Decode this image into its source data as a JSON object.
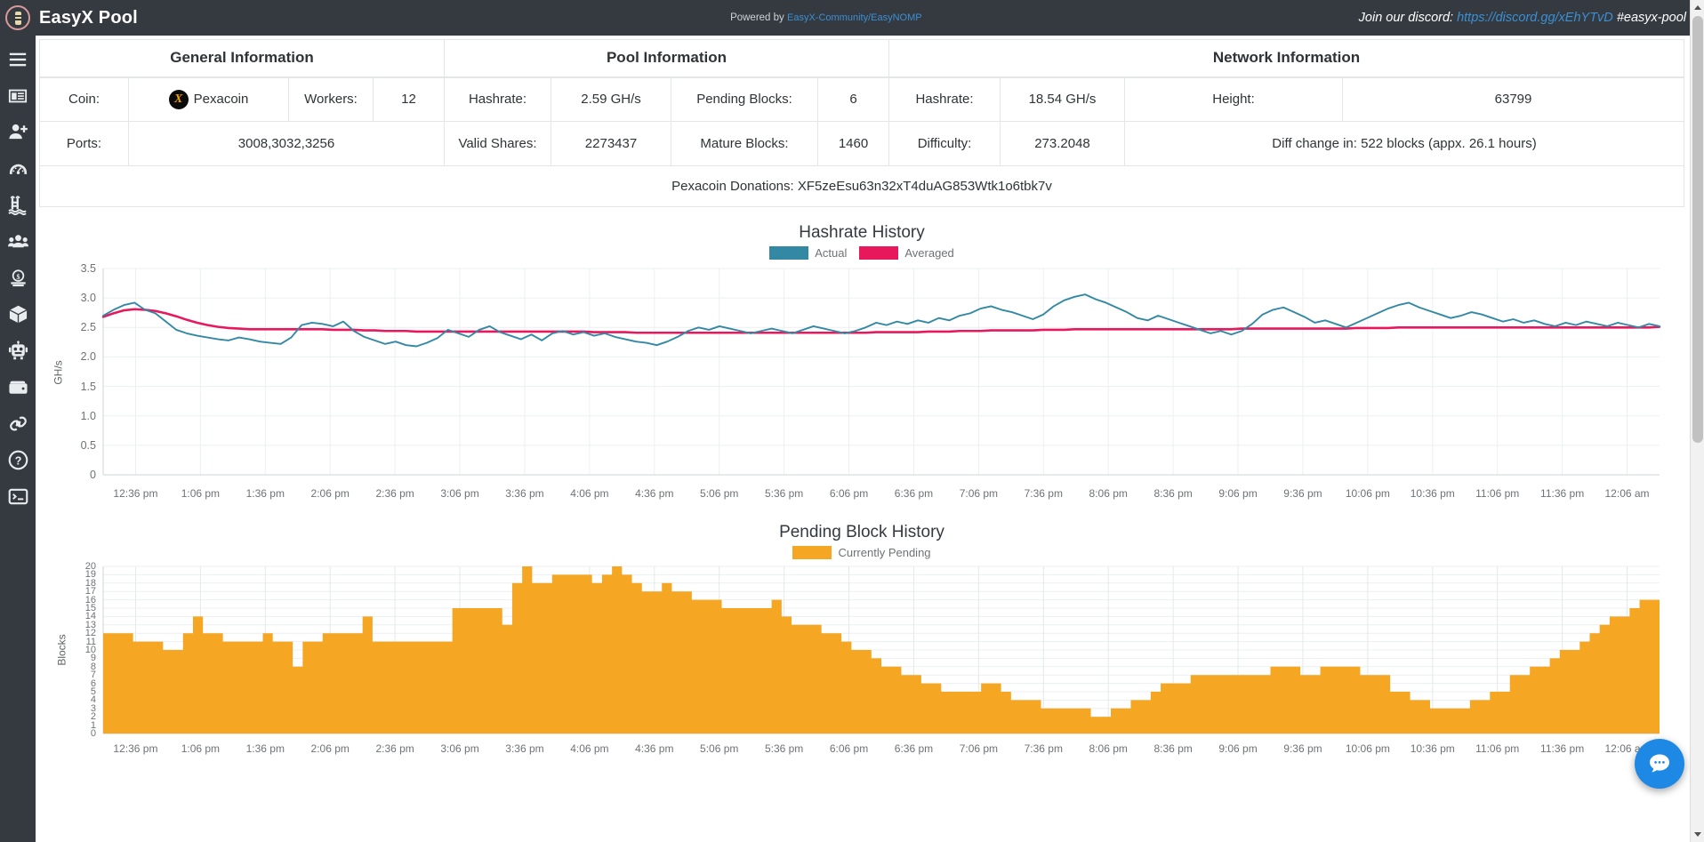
{
  "header": {
    "brand_title": "EasyX Pool",
    "logo_icon": "pool-logo-icon",
    "powered_prefix": "Powered by",
    "powered_link": "EasyX-Community/EasyNOMP",
    "discord_prefix": "Join our discord:",
    "discord_link": "https://discord.gg/xEhYTvD",
    "discord_channel": "#easyx-pool",
    "bg_color": "#343a40",
    "link_color": "#3b8fd4"
  },
  "sidebar": {
    "items": [
      {
        "icon": "hamburger-menu-icon",
        "label": "Menu"
      },
      {
        "icon": "news-article-icon",
        "label": "News"
      },
      {
        "icon": "user-add-icon",
        "label": "Get Started"
      },
      {
        "icon": "gauge-dashboard-icon",
        "label": "Dashboard"
      },
      {
        "icon": "pool-ladder-icon",
        "label": "Pool Stats"
      },
      {
        "icon": "users-group-icon",
        "label": "Miners"
      },
      {
        "icon": "coin-dollar-icon",
        "label": "Payments"
      },
      {
        "icon": "cube-block-icon",
        "label": "Blocks"
      },
      {
        "icon": "robot-icon",
        "label": "Bot"
      },
      {
        "icon": "wallet-icon",
        "label": "Wallet"
      },
      {
        "icon": "link-chain-icon",
        "label": "Links"
      },
      {
        "icon": "question-circle-icon",
        "label": "Help"
      },
      {
        "icon": "terminal-console-icon",
        "label": "Console"
      }
    ]
  },
  "info_table": {
    "group_headers": [
      "General Information",
      "Pool Information",
      "Network Information"
    ],
    "row1": [
      {
        "label": "Coin:",
        "value": "Pexacoin",
        "icon": "pexacoin-coin-icon"
      },
      {
        "label": "Workers:",
        "value": "12"
      },
      {
        "label": "Hashrate:",
        "value": "2.59 GH/s"
      },
      {
        "label": "Pending Blocks:",
        "value": "6"
      },
      {
        "label": "Hashrate:",
        "value": "18.54 GH/s"
      },
      {
        "label": "Height:",
        "value": "63799"
      }
    ],
    "row2": [
      {
        "label": "Ports:",
        "value": "3008,3032,3256"
      },
      {
        "label": "Valid Shares:",
        "value": "2273437"
      },
      {
        "label": "Mature Blocks:",
        "value": "1460"
      },
      {
        "label": "Difficulty:",
        "value": "273.2048"
      },
      {
        "label": "",
        "value": "Diff change in: 522 blocks (appx. 26.1 hours)"
      }
    ],
    "donations": "Pexacoin Donations: XF5zeEsu63n32xT4duAG853Wtk1o6tbk7v"
  },
  "chart_data": [
    {
      "type": "line",
      "title": "Hashrate History",
      "xlabel": "",
      "ylabel": "GH/s",
      "ylim": [
        0,
        3.5
      ],
      "ytick_labels": [
        "0",
        "0.5",
        "1.0",
        "1.5",
        "2.0",
        "2.5",
        "3.0",
        "3.5"
      ],
      "ytick_values": [
        0,
        0.5,
        1.0,
        1.5,
        2.0,
        2.5,
        3.0,
        3.5
      ],
      "grid": true,
      "legend_position": "top-center",
      "xtick_labels": [
        "12:36 pm",
        "1:06 pm",
        "1:36 pm",
        "2:06 pm",
        "2:36 pm",
        "3:06 pm",
        "3:36 pm",
        "4:06 pm",
        "4:36 pm",
        "5:06 pm",
        "5:36 pm",
        "6:06 pm",
        "6:36 pm",
        "7:06 pm",
        "7:36 pm",
        "8:06 pm",
        "8:36 pm",
        "9:06 pm",
        "9:36 pm",
        "10:06 pm",
        "10:36 pm",
        "11:06 pm",
        "11:36 pm",
        "12:06 am"
      ],
      "series": [
        {
          "name": "Actual",
          "color": "#3389a4",
          "values": [
            2.7,
            2.8,
            2.88,
            2.92,
            2.8,
            2.74,
            2.6,
            2.46,
            2.4,
            2.36,
            2.33,
            2.3,
            2.28,
            2.33,
            2.3,
            2.26,
            2.24,
            2.22,
            2.33,
            2.54,
            2.58,
            2.56,
            2.52,
            2.6,
            2.44,
            2.34,
            2.28,
            2.22,
            2.26,
            2.2,
            2.18,
            2.24,
            2.32,
            2.46,
            2.4,
            2.34,
            2.46,
            2.52,
            2.42,
            2.36,
            2.3,
            2.38,
            2.28,
            2.4,
            2.44,
            2.38,
            2.42,
            2.36,
            2.4,
            2.34,
            2.3,
            2.26,
            2.24,
            2.2,
            2.26,
            2.34,
            2.44,
            2.5,
            2.46,
            2.52,
            2.48,
            2.44,
            2.4,
            2.44,
            2.48,
            2.44,
            2.4,
            2.46,
            2.52,
            2.48,
            2.44,
            2.4,
            2.44,
            2.5,
            2.58,
            2.54,
            2.6,
            2.56,
            2.62,
            2.58,
            2.66,
            2.62,
            2.7,
            2.74,
            2.82,
            2.86,
            2.8,
            2.76,
            2.7,
            2.64,
            2.72,
            2.86,
            2.96,
            3.02,
            3.06,
            2.98,
            2.92,
            2.84,
            2.76,
            2.66,
            2.62,
            2.7,
            2.64,
            2.58,
            2.52,
            2.46,
            2.4,
            2.44,
            2.38,
            2.44,
            2.56,
            2.72,
            2.8,
            2.84,
            2.76,
            2.68,
            2.58,
            2.62,
            2.56,
            2.5,
            2.58,
            2.66,
            2.74,
            2.82,
            2.88,
            2.92,
            2.84,
            2.78,
            2.72,
            2.66,
            2.7,
            2.76,
            2.72,
            2.66,
            2.6,
            2.64,
            2.58,
            2.62,
            2.56,
            2.52,
            2.58,
            2.54,
            2.6,
            2.56,
            2.52,
            2.58,
            2.54,
            2.5,
            2.56,
            2.52
          ]
        },
        {
          "name": "Averaged",
          "color": "#e8185c",
          "values": [
            2.68,
            2.74,
            2.79,
            2.81,
            2.8,
            2.78,
            2.74,
            2.69,
            2.63,
            2.58,
            2.54,
            2.51,
            2.49,
            2.48,
            2.47,
            2.47,
            2.47,
            2.47,
            2.47,
            2.47,
            2.47,
            2.47,
            2.46,
            2.46,
            2.46,
            2.45,
            2.45,
            2.44,
            2.44,
            2.44,
            2.43,
            2.43,
            2.43,
            2.43,
            2.43,
            2.43,
            2.43,
            2.43,
            2.43,
            2.43,
            2.43,
            2.43,
            2.43,
            2.43,
            2.43,
            2.43,
            2.43,
            2.42,
            2.42,
            2.42,
            2.42,
            2.41,
            2.41,
            2.41,
            2.41,
            2.41,
            2.41,
            2.41,
            2.41,
            2.41,
            2.41,
            2.41,
            2.41,
            2.41,
            2.41,
            2.41,
            2.41,
            2.41,
            2.41,
            2.41,
            2.41,
            2.41,
            2.41,
            2.41,
            2.42,
            2.42,
            2.42,
            2.42,
            2.42,
            2.43,
            2.43,
            2.43,
            2.44,
            2.44,
            2.44,
            2.45,
            2.45,
            2.45,
            2.45,
            2.45,
            2.46,
            2.46,
            2.46,
            2.47,
            2.47,
            2.47,
            2.47,
            2.47,
            2.47,
            2.47,
            2.47,
            2.47,
            2.47,
            2.47,
            2.47,
            2.47,
            2.47,
            2.47,
            2.47,
            2.48,
            2.48,
            2.48,
            2.48,
            2.48,
            2.48,
            2.48,
            2.48,
            2.48,
            2.48,
            2.48,
            2.49,
            2.49,
            2.49,
            2.49,
            2.5,
            2.5,
            2.5,
            2.5,
            2.5,
            2.5,
            2.5,
            2.5,
            2.5,
            2.5,
            2.5,
            2.5,
            2.5,
            2.5,
            2.5,
            2.5,
            2.5,
            2.5,
            2.5,
            2.5,
            2.5,
            2.5,
            2.5,
            2.5,
            2.5,
            2.51
          ]
        }
      ]
    },
    {
      "type": "area",
      "title": "Pending Block History",
      "xlabel": "",
      "ylabel": "Blocks",
      "ylim": [
        0,
        20
      ],
      "ytick_labels": [
        "0",
        "1",
        "2",
        "3",
        "4",
        "5",
        "6",
        "7",
        "8",
        "9",
        "10",
        "11",
        "12",
        "13",
        "14",
        "15",
        "16",
        "17",
        "18",
        "19",
        "20"
      ],
      "grid": true,
      "legend_position": "top-center",
      "xtick_labels": [
        "12:36 pm",
        "1:06 pm",
        "1:36 pm",
        "2:06 pm",
        "2:36 pm",
        "3:06 pm",
        "3:36 pm",
        "4:06 pm",
        "4:36 pm",
        "5:06 pm",
        "5:36 pm",
        "6:06 pm",
        "6:36 pm",
        "7:06 pm",
        "7:36 pm",
        "8:06 pm",
        "8:36 pm",
        "9:06 pm",
        "9:36 pm",
        "10:06 pm",
        "10:36 pm",
        "11:06 pm",
        "11:36 pm",
        "12:06 am"
      ],
      "series": [
        {
          "name": "Currently Pending",
          "color": "#f5a623",
          "values": [
            12,
            12,
            12,
            11,
            11,
            11,
            10,
            10,
            12,
            14,
            12,
            12,
            11,
            11,
            11,
            11,
            12,
            11,
            11,
            8,
            11,
            11,
            12,
            12,
            12,
            12,
            14,
            11,
            11,
            11,
            11,
            11,
            11,
            11,
            11,
            15,
            15,
            15,
            15,
            15,
            13,
            18,
            20,
            18,
            18,
            19,
            19,
            19,
            19,
            18,
            19,
            20,
            19,
            18,
            17,
            17,
            18,
            17,
            17,
            16,
            16,
            16,
            15,
            15,
            15,
            15,
            15,
            16,
            14,
            13,
            13,
            13,
            12,
            12,
            11,
            10,
            10,
            9,
            8,
            8,
            7,
            7,
            6,
            6,
            5,
            5,
            5,
            5,
            6,
            6,
            5,
            4,
            4,
            4,
            3,
            3,
            3,
            3,
            3,
            2,
            2,
            3,
            3,
            4,
            4,
            5,
            6,
            6,
            6,
            7,
            7,
            7,
            7,
            7,
            7,
            7,
            7,
            8,
            8,
            8,
            7,
            7,
            8,
            8,
            8,
            8,
            7,
            7,
            7,
            5,
            5,
            4,
            4,
            3,
            3,
            3,
            3,
            4,
            4,
            5,
            5,
            7,
            7,
            8,
            8,
            9,
            10,
            10,
            11,
            12,
            13,
            14,
            14,
            15,
            16,
            16
          ]
        }
      ]
    }
  ],
  "chat_widget": {
    "icon": "chat-bubble-icon",
    "color": "#1e88e5"
  },
  "scrollbar": {
    "up_icon": "scroll-up-arrow-icon",
    "down_icon": "scroll-down-arrow-icon"
  }
}
